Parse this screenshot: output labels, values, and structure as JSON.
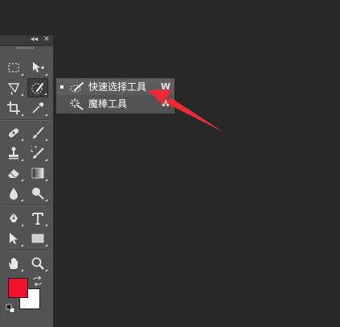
{
  "toolbar": {
    "collapse_icon": "double-chevron-left-icon",
    "close_icon": "close-icon",
    "collapse_glyph": "◂◂",
    "close_glyph": "✕"
  },
  "flyout": {
    "items": [
      {
        "label": "快速选择工具",
        "shortcut": "W",
        "icon": "quick-selection-icon",
        "selected": true
      },
      {
        "label": "魔棒工具",
        "shortcut": "W",
        "icon": "magic-wand-icon",
        "selected": false
      }
    ]
  },
  "colors": {
    "foreground": "#ee1230",
    "background": "#ffffff",
    "arrow": "#ee2a34",
    "panel": "#535353",
    "canvas": "#282828"
  }
}
